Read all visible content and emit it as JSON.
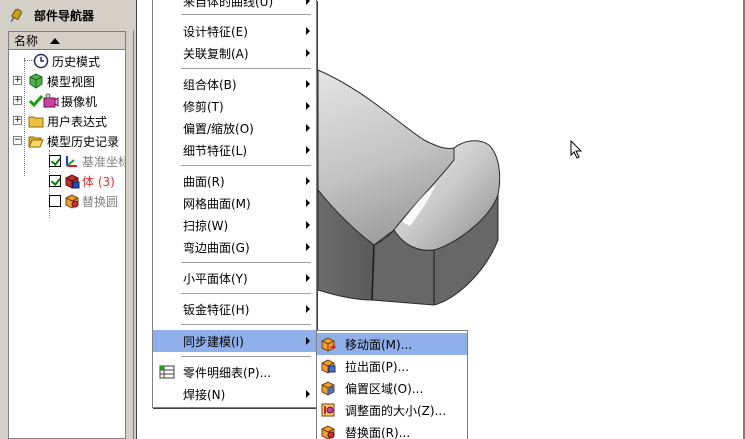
{
  "navigator": {
    "title": "部件导航器",
    "column_header": "名称",
    "tree": [
      {
        "label": "历史模式",
        "icon": "clock-icon"
      },
      {
        "label": "模型视图",
        "icon": "model-views-icon"
      },
      {
        "label": "摄像机",
        "icon": "camera-icon"
      },
      {
        "label": "用户表达式",
        "icon": "folder-icon"
      },
      {
        "label": "模型历史记录",
        "icon": "folder-open-icon"
      },
      {
        "label": "基准坐标",
        "icon": "datum-csys-icon"
      },
      {
        "label": "体 (3)",
        "icon": "body-icon"
      },
      {
        "label": "替换圆",
        "icon": "replace-face-icon"
      }
    ]
  },
  "menu": {
    "items": [
      {
        "label": "来自体的曲线(U)",
        "arrow": true
      },
      {
        "label": "设计特征(E)",
        "arrow": true
      },
      {
        "label": "关联复制(A)",
        "arrow": true
      },
      {
        "label": "组合体(B)",
        "arrow": true
      },
      {
        "label": "修剪(T)",
        "arrow": true
      },
      {
        "label": "偏置/缩放(O)",
        "arrow": true
      },
      {
        "label": "细节特征(L)",
        "arrow": true
      },
      {
        "label": "曲面(R)",
        "arrow": true
      },
      {
        "label": "网格曲面(M)",
        "arrow": true
      },
      {
        "label": "扫掠(W)",
        "arrow": true
      },
      {
        "label": "弯边曲面(G)",
        "arrow": true
      },
      {
        "label": "小平面体(Y)",
        "arrow": true
      },
      {
        "label": "钣金特征(H)",
        "arrow": true
      },
      {
        "label": "同步建模(I)",
        "arrow": true
      },
      {
        "label": "零件明细表(P)...",
        "arrow": false
      },
      {
        "label": "焊接(N)",
        "arrow": true
      }
    ]
  },
  "submenu": {
    "items": [
      {
        "label": "移动面(M)...",
        "icon": "move-face-icon"
      },
      {
        "label": "拉出面(P)...",
        "icon": "pull-face-icon"
      },
      {
        "label": "偏置区域(O)...",
        "icon": "offset-region-icon"
      },
      {
        "label": "调整面的大小(Z)...",
        "icon": "resize-face-icon"
      },
      {
        "label": "替换面(R)...",
        "icon": "replace-face-icon"
      }
    ]
  },
  "colors": {
    "highlight": "#8fb0ea",
    "body_red_label": "#e03030",
    "greyed_label": "#808080"
  }
}
